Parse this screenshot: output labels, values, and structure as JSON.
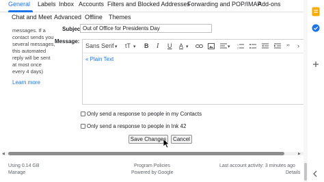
{
  "tabs_row1": [
    "General",
    "Labels",
    "Inbox",
    "Accounts",
    "Filters and Blocked Addresses",
    "Forwarding and POP/IMAP",
    "Add-ons"
  ],
  "tabs_row2": [
    "Chat and Meet",
    "Advanced",
    "Offline",
    "Themes"
  ],
  "active_tab": "General",
  "help_lines": [
    "messages. If a",
    "contact sends you",
    "several messages,",
    "this automated",
    "reply will be sent",
    "at most once",
    "every 4 days)"
  ],
  "learn_more": "Learn more",
  "subject_label": "Subject:",
  "subject_value": "Out of Office for Presidents Day",
  "message_label": "Message:",
  "toolbar": {
    "font": "Sans Serif",
    "font_dropdown": "▾",
    "size_icon": "tT",
    "bold": "B",
    "italic": "I",
    "underline": "U",
    "text_color": "A",
    "more": "›"
  },
  "plain_text_link": "« Plain Text",
  "check_contacts": "Only send a response to people in my Contacts",
  "check_ink": "Only send a response to people in Ink 42",
  "save_button": "Save Changes",
  "cancel_button": "Cancel",
  "footer": {
    "storage": "Using 0.14 GB",
    "manage": "Manage",
    "program_policies": "Program Policies",
    "powered_by": "Powered by Google",
    "last_activity": "Last account activity: 3 minutes ago",
    "details": "Details"
  },
  "colors": {
    "accent": "#1a73e8",
    "side_yellow": "#f9ab00",
    "side_blue": "#1a73e8"
  },
  "side_icons": [
    "notes-icon",
    "tasks-icon",
    "add-icon"
  ]
}
